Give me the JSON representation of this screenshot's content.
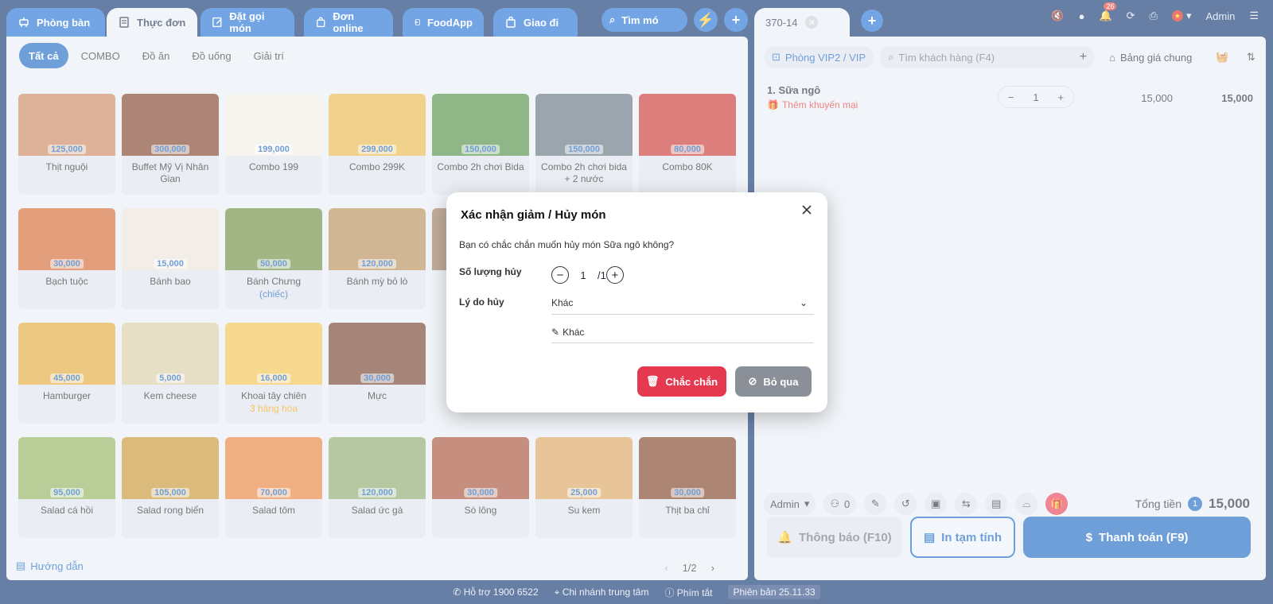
{
  "top_tabs": [
    {
      "label": "Phòng bàn",
      "icon": "table-icon"
    },
    {
      "label": "Thực đơn",
      "icon": "menu-icon",
      "active": true
    },
    {
      "label": "Đặt gọi món",
      "icon": "order-icon"
    },
    {
      "label": "Đơn online",
      "icon": "bag-icon"
    },
    {
      "label": "FoodApp",
      "icon": "app-icon"
    },
    {
      "label": "Giao đi",
      "icon": "bag-icon"
    }
  ],
  "search": {
    "label": "Tìm mó"
  },
  "categories": [
    "Tất cả",
    "COMBO",
    "Đồ ăn",
    "Đồ uống",
    "Giải trí"
  ],
  "products": [
    {
      "price": "125,000",
      "name": "Thịt nguội",
      "color": "#c8845a"
    },
    {
      "price": "300,000",
      "name": "Buffet Mỹ Vị Nhân Gian",
      "color": "#7a3a22"
    },
    {
      "price": "199,000",
      "name": "Combo 199",
      "color": "#f1ede6"
    },
    {
      "price": "299,000",
      "name": "Combo 299K",
      "color": "#e7b746"
    },
    {
      "price": "150,000",
      "name": "Combo 2h chơi Bida",
      "color": "#4a8a3c"
    },
    {
      "price": "150,000",
      "name": "Combo 2h chơi bida + 2 nước",
      "color": "#5d6e7c"
    },
    {
      "price": "80,000",
      "name": "Combo 80K",
      "color": "#c7302a"
    },
    {
      "price": "30,000",
      "name": "Bạch tuộc",
      "color": "#d2632c"
    },
    {
      "price": "15,000",
      "name": "Bánh bao",
      "color": "#ebe4d8"
    },
    {
      "price": "50,000",
      "name": "Bánh Chưng",
      "sub": "(chiếc)",
      "sub_color": "#1565c0",
      "color": "#6a8a3a"
    },
    {
      "price": "120,000",
      "name": "Bánh mỳ bỏ lò",
      "color": "#b48952"
    },
    {
      "price": "",
      "name": "",
      "color": "#9a7a5a"
    },
    {
      "price": "",
      "name": "",
      "color": "#e9eef5"
    },
    {
      "price": "",
      "name": "",
      "color": "#e9eef5"
    },
    {
      "price": "45,000",
      "name": "Hamburger",
      "color": "#e3a632"
    },
    {
      "price": "5,000",
      "name": "Kem cheese",
      "color": "#d8cba2"
    },
    {
      "price": "16,000",
      "name": "Khoai tây chiên",
      "sub": "3 hàng hóa",
      "sub_color": "#f59e0b",
      "color": "#f0c049"
    },
    {
      "price": "30,000",
      "name": "Mực",
      "color": "#6d3a26"
    },
    {
      "price": "",
      "name": "",
      "color": "#e9eef5"
    },
    {
      "price": "",
      "name": "",
      "color": "#e9eef5"
    },
    {
      "price": "",
      "name": "",
      "color": "#e9eef5"
    },
    {
      "price": "95,000",
      "name": "Salad cá hồi",
      "color": "#8fae5a"
    },
    {
      "price": "105,000",
      "name": "Salad rong biển",
      "color": "#c4922d"
    },
    {
      "price": "70,000",
      "name": "Salad tôm",
      "color": "#e77d38"
    },
    {
      "price": "120,000",
      "name": "Salad ức gà",
      "color": "#8aa76a"
    },
    {
      "price": "30,000",
      "name": "Sò lông",
      "color": "#a24a30"
    },
    {
      "price": "25,000",
      "name": "Su kem",
      "color": "#d9a25a"
    },
    {
      "price": "30,000",
      "name": "Thịt ba chỉ",
      "color": "#7b3a1e"
    }
  ],
  "guide_label": "Hướng dẫn",
  "pager": {
    "page": "1/2"
  },
  "right": {
    "table_tab": "370-14",
    "admin": "Admin",
    "notif_count": "26",
    "room": "Phòng VIP2 / VIP",
    "customer_placeholder": "Tìm khách hàng (F4)",
    "price_list": "Bảng giá chung",
    "item": {
      "name": "1. Sữa ngô",
      "promo": "Thêm khuyến mại",
      "qty": "1",
      "unit_price": "15,000",
      "total": "15,000"
    },
    "footer": {
      "staff": "Admin",
      "count": "0"
    },
    "total_label": "Tổng tiền",
    "total_count": "1",
    "total_amount": "15,000",
    "btn_notify": "Thông báo (F10)",
    "btn_print": "In tạm tính",
    "btn_pay": "Thanh toán (F9)"
  },
  "status": {
    "support": "Hỗ trợ 1900 6522",
    "branch": "Chi nhánh trung tâm",
    "shortcut": "Phím tắt",
    "version": "Phiên bản 25.11.33"
  },
  "modal": {
    "title": "Xác nhận giảm / Hủy món",
    "message": "Bạn có chắc chắn muốn hủy món Sữa ngô không?",
    "qty_label": "Số lượng hủy",
    "qty_value": "1",
    "qty_max": "/1",
    "reason_label": "Lý do hủy",
    "reason_value": "Khác",
    "note_value": "Khác",
    "confirm": "Chắc chắn",
    "skip": "Bỏ qua"
  }
}
